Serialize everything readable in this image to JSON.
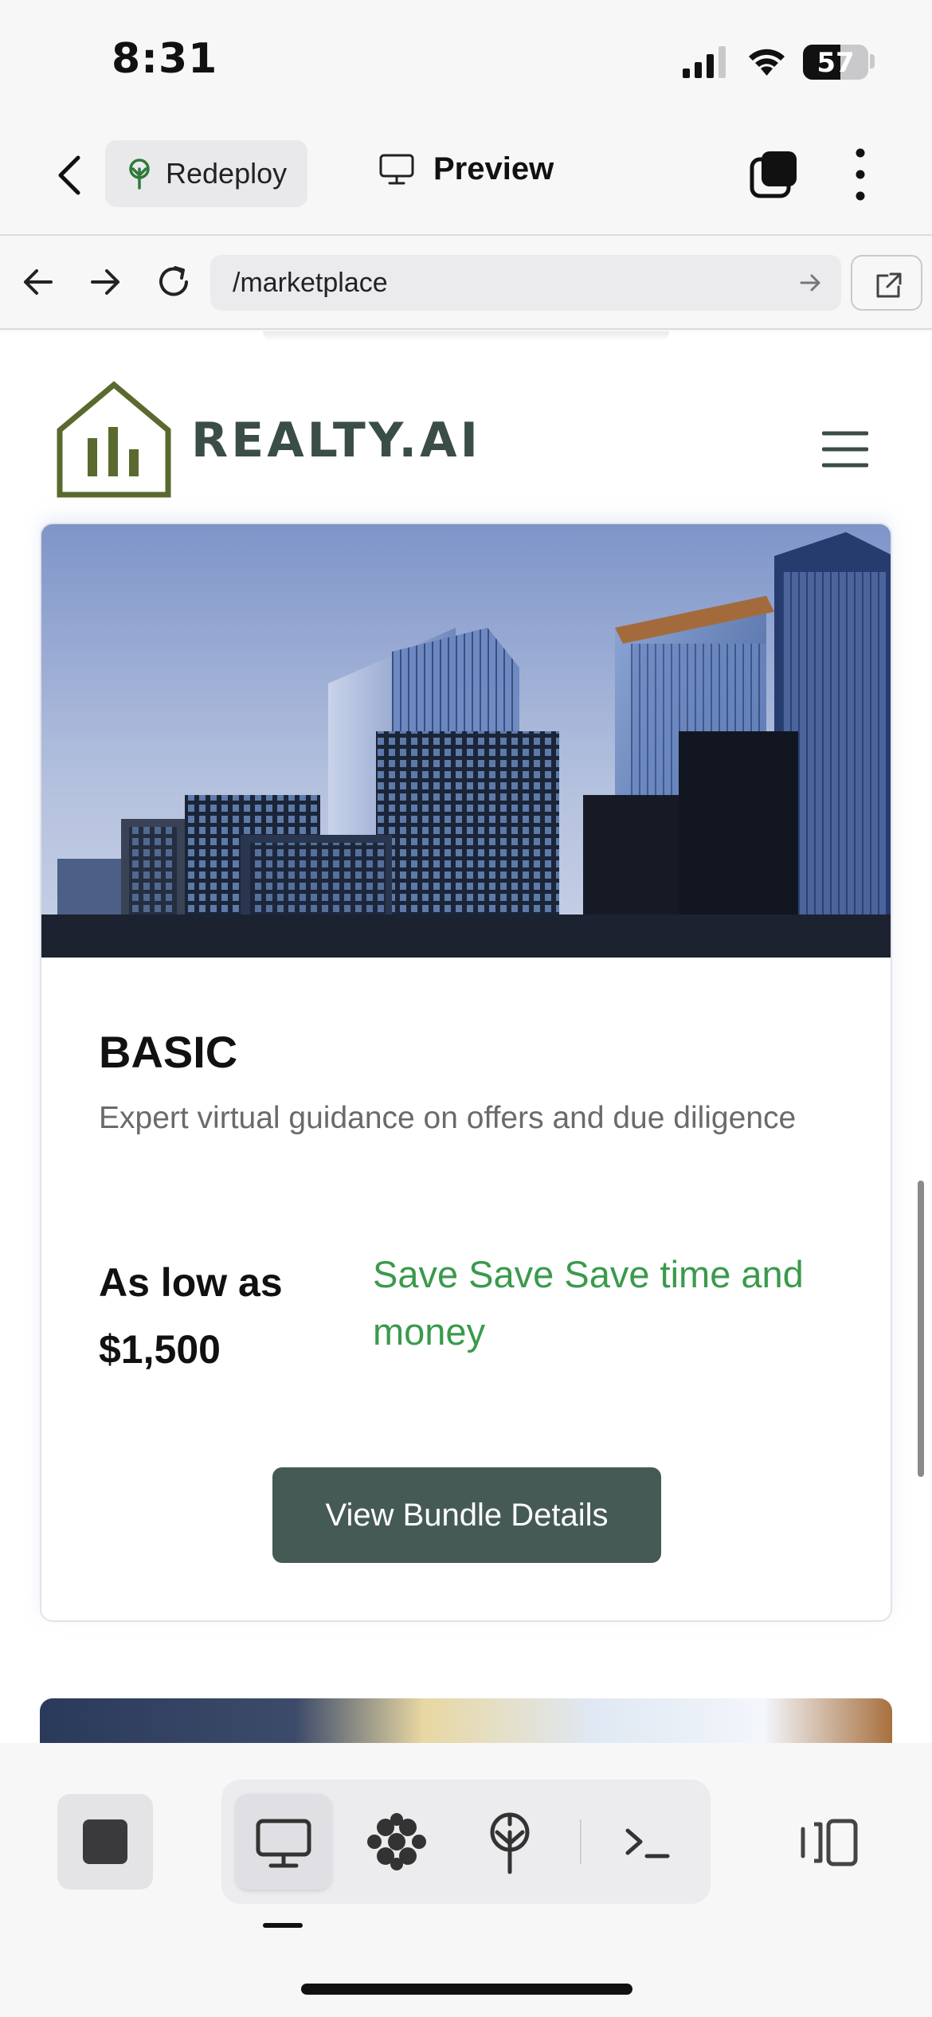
{
  "status_bar": {
    "time": "8:31",
    "battery": "57",
    "battery_level": 0.57
  },
  "app_bar": {
    "redeploy_label": "Redeploy",
    "preview_label": "Preview"
  },
  "url_bar": {
    "url": "/marketplace"
  },
  "site": {
    "brand": "REALTY.AI",
    "brand_color": "#3b4d47",
    "logo_color": "#5a6a2e"
  },
  "card": {
    "plan": "BASIC",
    "description": "Expert virtual guidance on offers and due diligence",
    "price_label": "As low as $1,500",
    "save_text": "Save Save Save time and money",
    "save_color": "#3a9a4c",
    "cta_label": "View Bundle Details",
    "cta_color": "#465a55"
  },
  "toolbar": {
    "icons": [
      "stop-icon",
      "desktop-icon",
      "extensions-icon",
      "deploy-icon",
      "terminal-icon",
      "panel-toggle-icon"
    ],
    "active": "desktop-icon"
  }
}
